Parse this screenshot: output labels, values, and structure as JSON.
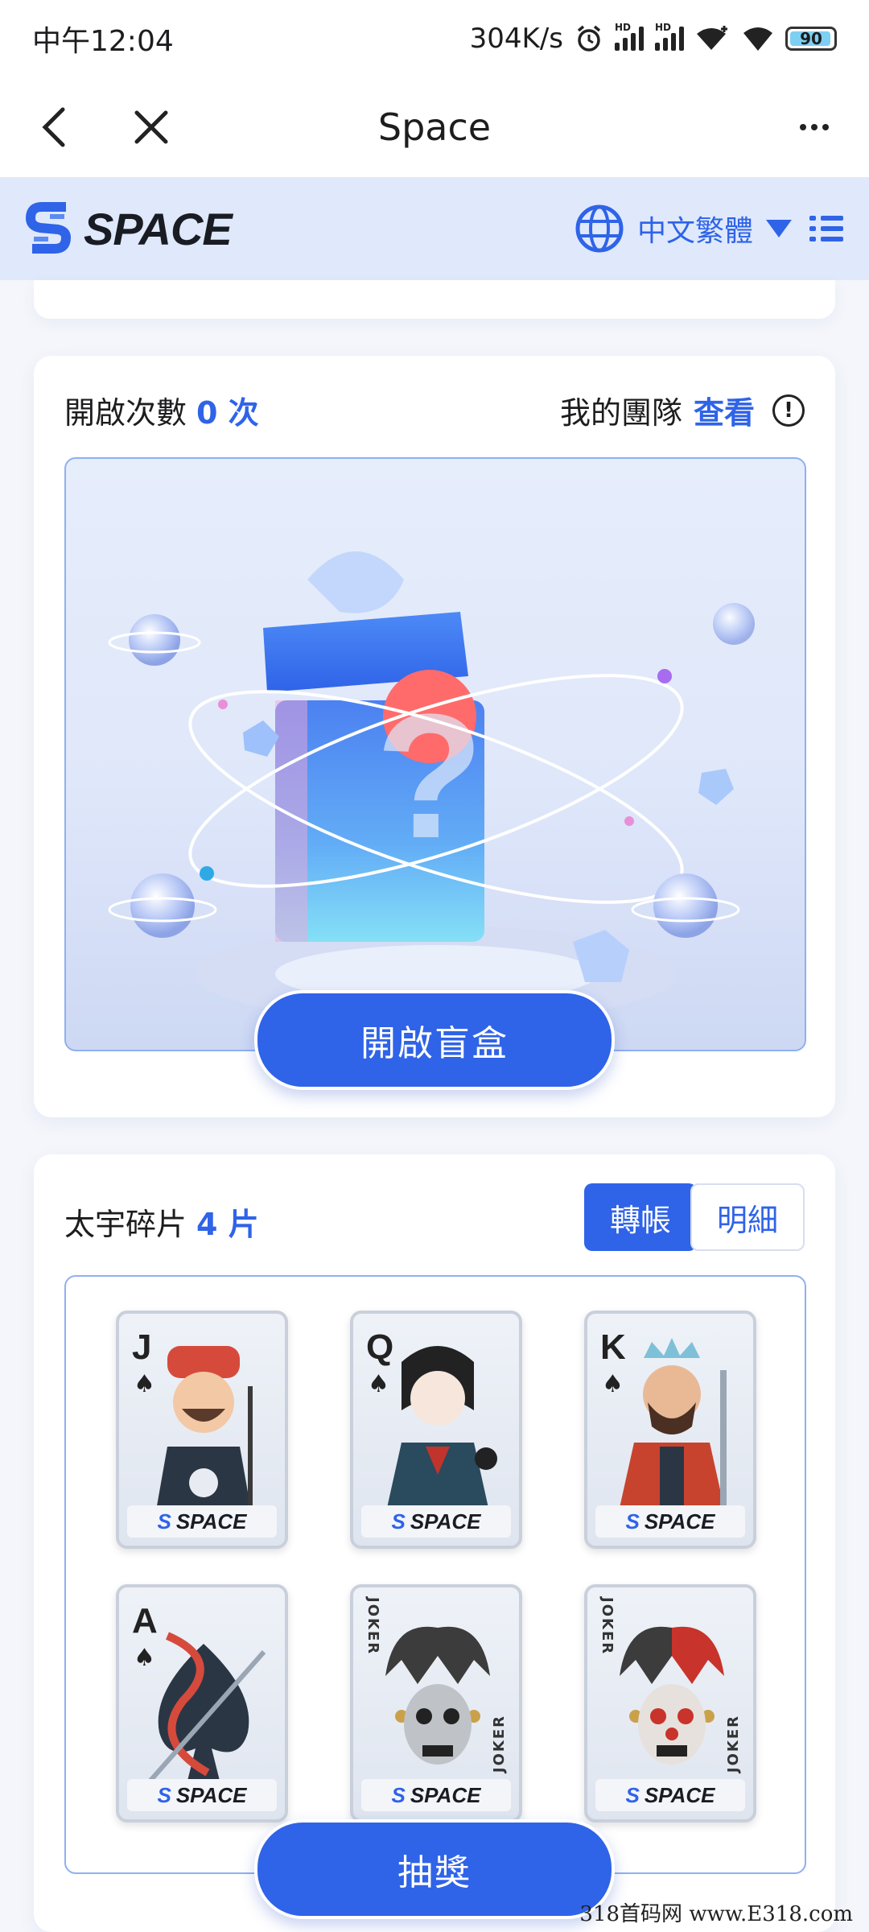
{
  "status_bar": {
    "time": "中午12:04",
    "net_speed": "304K/s",
    "hd1": "HD",
    "hd2": "HD",
    "battery": "90"
  },
  "navbar": {
    "title": "Space",
    "back_icon": "chevron-left-icon",
    "close_icon": "close-icon",
    "more_icon": "more-horizontal-icon"
  },
  "site_header": {
    "logo_text": "SPACE",
    "language": "中文繁體",
    "globe_icon": "globe-icon",
    "menu_icon": "list-menu-icon"
  },
  "blind_box": {
    "label": "開啟次數",
    "count": "0 次",
    "team_label": "我的團隊",
    "team_link": "查看",
    "info_icon_text": "!",
    "open_button": "開啟盲盒"
  },
  "fragments": {
    "label": "太宇碎片",
    "count": "4 片",
    "transfer_button": "轉帳",
    "detail_button": "明細",
    "cards": [
      {
        "rank": "J",
        "suit": "♠",
        "brand": "SPACE"
      },
      {
        "rank": "Q",
        "suit": "♠",
        "brand": "SPACE"
      },
      {
        "rank": "K",
        "suit": "♠",
        "brand": "SPACE"
      },
      {
        "rank": "A",
        "suit": "♠",
        "brand": "SPACE"
      },
      {
        "rank": "JOKER",
        "suit": "",
        "brand": "SPACE"
      },
      {
        "rank": "JOKER",
        "suit": "",
        "brand": "SPACE"
      }
    ],
    "draw_button": "抽獎"
  },
  "watermark": "318首码网  www.E318.com",
  "colors": {
    "accent": "#2f63e8",
    "header_bg": "#dfe9fb",
    "page_bg": "#f4f6fb"
  }
}
